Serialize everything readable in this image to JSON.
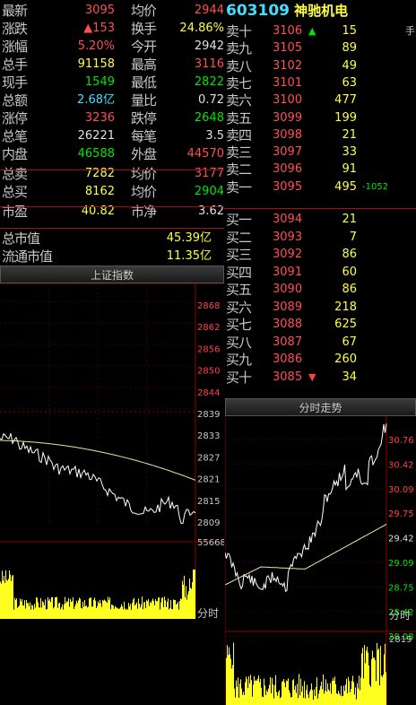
{
  "quote": {
    "rows": [
      {
        "l": "最新",
        "v": "3095",
        "vc": "red",
        "l2": "均价",
        "v2": "2944",
        "v2c": "red"
      },
      {
        "l": "涨跌",
        "v": "▲153",
        "vc": "red",
        "l2": "换手",
        "v2": "24.86%",
        "v2c": "yellow"
      },
      {
        "l": "涨幅",
        "v": "5.20%",
        "vc": "red",
        "l2": "今开",
        "v2": "2942",
        "v2c": "white"
      },
      {
        "l": "总手",
        "v": "91158",
        "vc": "yellow",
        "l2": "最高",
        "v2": "3116",
        "v2c": "red"
      },
      {
        "l": "现手",
        "v": "1549",
        "vc": "green",
        "l2": "最低",
        "v2": "2822",
        "v2c": "green"
      },
      {
        "l": "总额",
        "v": "2.68亿",
        "vc": "cyan",
        "l2": "量比",
        "v2": "0.72",
        "v2c": "white"
      },
      {
        "l": "涨停",
        "v": "3236",
        "vc": "red",
        "l2": "跌停",
        "v2": "2648",
        "v2c": "green"
      },
      {
        "l": "总笔",
        "v": "26221",
        "vc": "white",
        "l2": "每笔",
        "v2": "3.5",
        "v2c": "white"
      },
      {
        "l": "内盘",
        "v": "46588",
        "vc": "green",
        "l2": "外盘",
        "v2": "44570",
        "v2c": "red"
      },
      {
        "l": "总卖",
        "v": "7282",
        "vc": "yellow",
        "l2": "均价",
        "v2": "3177",
        "v2c": "red"
      },
      {
        "l": "总买",
        "v": "8162",
        "vc": "yellow",
        "l2": "均价",
        "v2": "2904",
        "v2c": "green"
      },
      {
        "l": "市盈",
        "v": "40.82",
        "vc": "yellow",
        "l2": "市净",
        "v2": "3.62",
        "v2c": "white"
      }
    ],
    "mcap_label": "总市值",
    "mcap": "45.39亿",
    "float_label": "流通市值",
    "float": "11.35亿"
  },
  "stock": {
    "code": "603109",
    "name": "神驰机电",
    "side_label": "手"
  },
  "orderbook": {
    "sell": [
      {
        "l": "卖十",
        "p": "3106",
        "v": "15",
        "flag": "up"
      },
      {
        "l": "卖九",
        "p": "3105",
        "v": "89"
      },
      {
        "l": "卖八",
        "p": "3102",
        "v": "49"
      },
      {
        "l": "卖七",
        "p": "3101",
        "v": "63"
      },
      {
        "l": "卖六",
        "p": "3100",
        "v": "477"
      },
      {
        "l": "卖五",
        "p": "3099",
        "v": "199"
      },
      {
        "l": "卖四",
        "p": "3098",
        "v": "21"
      },
      {
        "l": "卖三",
        "p": "3097",
        "v": "33"
      },
      {
        "l": "卖二",
        "p": "3096",
        "v": "91"
      },
      {
        "l": "卖一",
        "p": "3095",
        "v": "495",
        "chg": "-1052"
      }
    ],
    "buy": [
      {
        "l": "买一",
        "p": "3094",
        "v": "21"
      },
      {
        "l": "买二",
        "p": "3093",
        "v": "7"
      },
      {
        "l": "买三",
        "p": "3092",
        "v": "86"
      },
      {
        "l": "买四",
        "p": "3091",
        "v": "60"
      },
      {
        "l": "买五",
        "p": "3090",
        "v": "86"
      },
      {
        "l": "买六",
        "p": "3089",
        "v": "218"
      },
      {
        "l": "买七",
        "p": "3088",
        "v": "625"
      },
      {
        "l": "买八",
        "p": "3087",
        "v": "67"
      },
      {
        "l": "买九",
        "p": "3086",
        "v": "260"
      },
      {
        "l": "买十",
        "p": "3085",
        "v": "34",
        "flag": "down"
      }
    ]
  },
  "index_chart": {
    "title": "上证指数",
    "ticks": [
      "2868",
      "2862",
      "2856",
      "2850",
      "2844",
      "2839",
      "2833",
      "2827",
      "2821",
      "2815",
      "2809"
    ],
    "vol_label": "55668",
    "footer": "分时",
    "colors": {
      "red": "#ff4040",
      "green": "#00e600",
      "cyan": "#40e0ff",
      "grid": "#8b0000"
    }
  },
  "stock_chart": {
    "title": "分时走势",
    "ticks": [
      "30.76",
      "30.42",
      "30.09",
      "29.75",
      "29.42",
      "29.09",
      "28.75",
      "28.42",
      "28.08"
    ],
    "tick_colors": [
      "red",
      "red",
      "red",
      "red",
      "white",
      "green",
      "green",
      "green",
      "green"
    ],
    "vol_label": "2819",
    "footer": "分时"
  }
}
